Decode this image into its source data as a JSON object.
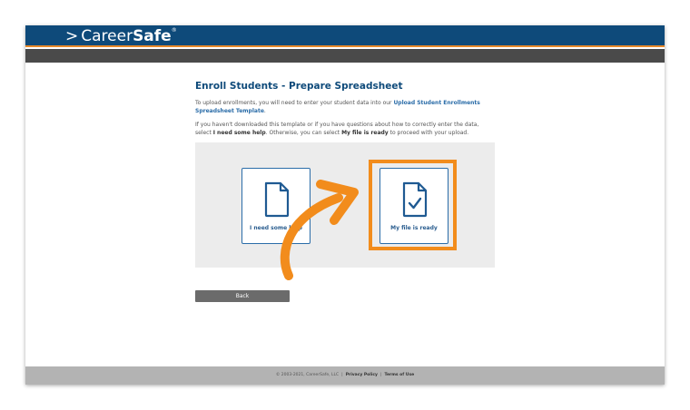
{
  "brand": {
    "prefix": ">",
    "part1": "Career",
    "part2": "Safe",
    "mark": "®"
  },
  "page": {
    "title": "Enroll Students - Prepare Spreadsheet",
    "p1_text": "To upload enrollments, you will need to enter your student data into our ",
    "p1_link": "Upload Student Enrollments Spreadsheet Template",
    "p1_end": ".",
    "p2_a": "If you haven't downloaded this template or if you have questions about how to correctly enter the data, select ",
    "p2_b": "I need some help",
    "p2_c": ". Otherwise, you can select ",
    "p2_d": "My file is ready",
    "p2_e": " to proceed with your upload."
  },
  "options": {
    "help_label": "I need some help",
    "ready_label": "My file is ready"
  },
  "back_label": "Back",
  "footer": {
    "copyright": "© 2003-2021, CareerSafe, LLC",
    "separator": "|",
    "privacy": "Privacy Policy",
    "terms": "Terms of Use"
  },
  "colors": {
    "header_blue": "#0e4a7a",
    "accent_orange": "#f28c1c",
    "link_blue": "#2a6ca8",
    "button_gray": "#6b6b6b"
  },
  "icons": {
    "help_card": "document-icon",
    "ready_card": "document-check-icon",
    "callout": "curved-arrow-icon"
  }
}
